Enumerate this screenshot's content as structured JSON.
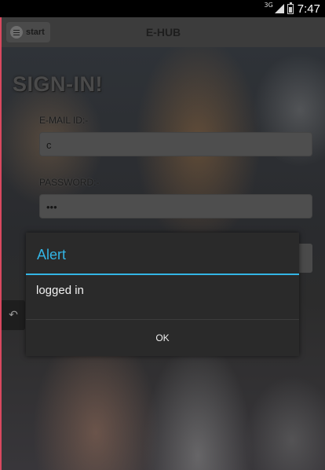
{
  "status_bar": {
    "network_type": "3G",
    "signal_icon": "signal-icon",
    "battery_icon": "battery-icon",
    "time": "7:47"
  },
  "action_bar": {
    "menu_icon": "menu-icon",
    "start_label": "start",
    "title": "E-HUB"
  },
  "form": {
    "heading": "SIGN-IN!",
    "email_label": "E-MAIL ID:-",
    "email_value": "c",
    "password_label": "PASSWORD:-",
    "password_value": "•••",
    "back_icon": "undo-icon"
  },
  "dialog": {
    "title": "Alert",
    "message": "logged in",
    "ok_label": "OK",
    "accent_color": "#33b5e5"
  }
}
